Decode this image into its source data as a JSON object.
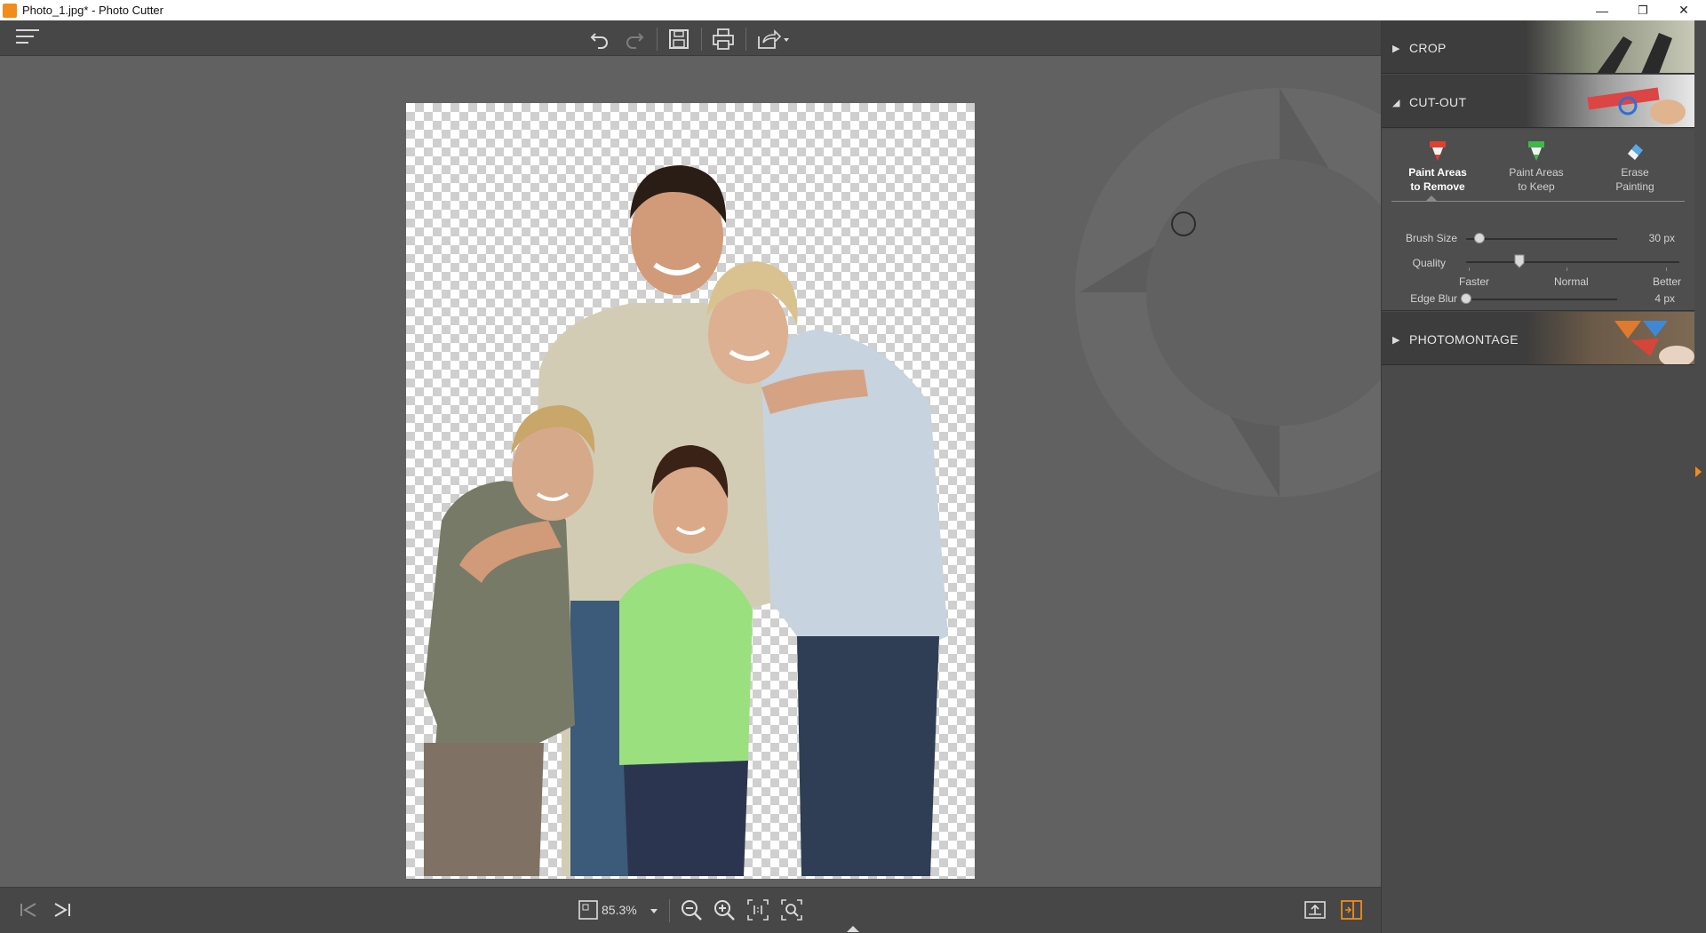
{
  "window": {
    "title": "Photo_1.jpg* - Photo Cutter",
    "minimize_glyph": "—",
    "restore_glyph": "❐",
    "close_glyph": "✕"
  },
  "toolbar": {
    "icons": [
      "menu-icon",
      "undo-icon",
      "redo-icon",
      "save-icon",
      "print-icon",
      "share-icon"
    ]
  },
  "status": {
    "zoom": "85.3%",
    "icons": [
      "first-image-icon",
      "next-image-icon",
      "fit-window-icon",
      "zoom-out-icon",
      "zoom-in-icon",
      "actual-size-icon",
      "zoom-region-icon",
      "import-icon",
      "compare-view-icon"
    ]
  },
  "panel": {
    "sections": {
      "crop": "CROP",
      "cutout": "CUT-OUT",
      "photomontage": "PHOTOMONTAGE"
    },
    "tools": [
      {
        "line1": "Paint Areas",
        "line2": "to Remove",
        "active": true,
        "color": "#e0412f"
      },
      {
        "line1": "Paint Areas",
        "line2": "to Keep",
        "active": false,
        "color": "#3fb84a"
      },
      {
        "line1": "Erase",
        "line2": "Painting",
        "active": false,
        "color": "#5aa7e6"
      }
    ],
    "brush_size": {
      "label": "Brush Size",
      "value": "30 px",
      "level": 0.09
    },
    "quality": {
      "label": "Quality",
      "options": [
        "Faster",
        "Normal",
        "Better"
      ],
      "level": 0.25
    },
    "edge_blur": {
      "label": "Edge Blur",
      "value": "4 px",
      "level": 0.0
    }
  },
  "colors": {
    "accent": "#f28c1a",
    "panel_bg": "#4a4a4a",
    "toolbar_bg": "#474747",
    "canvas_bg": "#616161"
  }
}
